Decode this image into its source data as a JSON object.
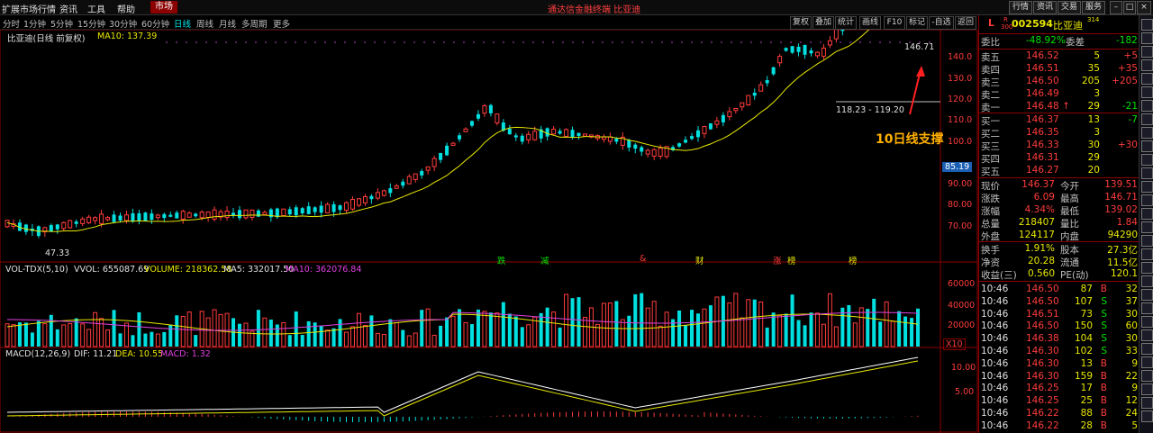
{
  "menu": {
    "items": [
      "扩展市场行情",
      "资讯",
      "工具",
      "帮助"
    ],
    "active": "市场",
    "center_title": "通达信金融终端  比亚迪",
    "right_buttons": [
      "行情",
      "资讯",
      "交易",
      "服务"
    ]
  },
  "periods": [
    "分时",
    "1分钟",
    "5分钟",
    "15分钟",
    "30分钟",
    "60分钟",
    "日线",
    "周线",
    "月线",
    "多周期",
    "更多"
  ],
  "period_selected": "日线",
  "tools": [
    "复权",
    "叠加",
    "统计",
    "画线",
    "F10",
    "标记",
    "-自选",
    "返回"
  ],
  "main_chart": {
    "title": "比亚迪(日线 前复权)",
    "ma_label": "MA10: 137.39",
    "price_axis": [
      "140.0",
      "130.0",
      "120.0",
      "110.0",
      "100.0",
      "90.00",
      "80.00",
      "70.00",
      "60.00"
    ],
    "current_price_tag": "85.19",
    "high_label": "146.71",
    "low_label": "47.33",
    "range_label": "118.23 - 119.20",
    "annotation": "10日线支撑",
    "event_markers": [
      {
        "text": "跌",
        "color": "#00e000"
      },
      {
        "text": "减",
        "color": "#00e000"
      },
      {
        "text": "&",
        "color": "#ff3c3c"
      },
      {
        "text": "财",
        "color": "#e0e000"
      },
      {
        "text": "涨",
        "color": "#ff3c3c"
      },
      {
        "text": "榜",
        "color": "#e0e000"
      },
      {
        "text": "榜",
        "color": "#e0e000"
      }
    ]
  },
  "vol_chart": {
    "title": "VOL-TDX(5,10)",
    "vvol": "VVOL: 655087.69",
    "volume": "VOLUME: 218362.58",
    "ma5": "MA5: 332017.50",
    "ma10": "MA10: 362076.84",
    "axis": [
      "60000",
      "40000",
      "20000"
    ],
    "unit": "X10"
  },
  "macd_chart": {
    "title": "MACD(12,26,9)",
    "dif": "DIF: 11.21",
    "dea": "DEA: 10.55",
    "macd": "MACD: 1.32",
    "axis": [
      "10.00",
      "5.00"
    ]
  },
  "panel": {
    "code": "002594",
    "name": "比亚迪",
    "flag_l": "L",
    "flag_r": "R",
    "flag_num": "300",
    "flag_sup": "314",
    "weibi_label": "委比",
    "weibi": "-48.92%",
    "weicha_label": "委差",
    "weicha": "-182",
    "asks": [
      {
        "label": "卖五",
        "price": "146.52",
        "vol": "5",
        "chg": "+5"
      },
      {
        "label": "卖四",
        "price": "146.51",
        "vol": "35",
        "chg": "+35"
      },
      {
        "label": "卖三",
        "price": "146.50",
        "vol": "205",
        "chg": "+205"
      },
      {
        "label": "卖二",
        "price": "146.49",
        "vol": "3",
        "chg": ""
      },
      {
        "label": "卖一",
        "price": "146.48 ↑",
        "vol": "29",
        "chg": "-21"
      }
    ],
    "bids": [
      {
        "label": "买一",
        "price": "146.37",
        "vol": "13",
        "chg": "-7"
      },
      {
        "label": "买二",
        "price": "146.35",
        "vol": "3",
        "chg": ""
      },
      {
        "label": "买三",
        "price": "146.33",
        "vol": "30",
        "chg": "+30"
      },
      {
        "label": "买四",
        "price": "146.31",
        "vol": "29",
        "chg": ""
      },
      {
        "label": "买五",
        "price": "146.27",
        "vol": "20",
        "chg": ""
      }
    ],
    "stats": [
      {
        "l1": "现价",
        "v1": "146.37",
        "l2": "今开",
        "v2": "139.51"
      },
      {
        "l1": "涨跌",
        "v1": "6.09",
        "l2": "最高",
        "v2": "146.71"
      },
      {
        "l1": "涨幅",
        "v1": "4.34%",
        "l2": "最低",
        "v2": "139.02"
      },
      {
        "l1": "总量",
        "v1": "218407",
        "l2": "量比",
        "v2": "1.84"
      },
      {
        "l1": "外盘",
        "v1": "124117",
        "l2": "内盘",
        "v2": "94290"
      }
    ],
    "stats2": [
      {
        "l1": "换手",
        "v1": "1.91%",
        "l2": "股本",
        "v2": "27.3亿"
      },
      {
        "l1": "净资",
        "v1": "20.28",
        "l2": "流通",
        "v2": "11.5亿"
      },
      {
        "l1": "收益(三)",
        "v1": "0.560",
        "l2": "PE(动)",
        "v2": "120.1"
      }
    ],
    "ticks": [
      {
        "time": "10:46",
        "price": "146.50",
        "vol": "87",
        "side": "B",
        "n": "32"
      },
      {
        "time": "10:46",
        "price": "146.50",
        "vol": "107",
        "side": "S",
        "n": "37"
      },
      {
        "time": "10:46",
        "price": "146.51",
        "vol": "73",
        "side": "S",
        "n": "30"
      },
      {
        "time": "10:46",
        "price": "146.50",
        "vol": "150",
        "side": "S",
        "n": "60"
      },
      {
        "time": "10:46",
        "price": "146.38",
        "vol": "104",
        "side": "S",
        "n": "30"
      },
      {
        "time": "10:46",
        "price": "146.30",
        "vol": "102",
        "side": "S",
        "n": "33"
      },
      {
        "time": "10:46",
        "price": "146.30",
        "vol": "13",
        "side": "B",
        "n": "9"
      },
      {
        "time": "10:46",
        "price": "146.30",
        "vol": "159",
        "side": "B",
        "n": "22"
      },
      {
        "time": "10:46",
        "price": "146.25",
        "vol": "17",
        "side": "B",
        "n": "9"
      },
      {
        "time": "10:46",
        "price": "146.25",
        "vol": "25",
        "side": "B",
        "n": "12"
      },
      {
        "time": "10:46",
        "price": "146.22",
        "vol": "88",
        "side": "B",
        "n": "24"
      },
      {
        "time": "10:46",
        "price": "146.22",
        "vol": "28",
        "side": "B",
        "n": "5"
      }
    ]
  },
  "colors": {
    "up": "#ff3c3c",
    "down": "#00e0e0",
    "ma": "#e8e800",
    "ma10": "#e040e0",
    "dif": "#ffffff",
    "grid": "#8b0000",
    "annotation": "#ffb000"
  }
}
